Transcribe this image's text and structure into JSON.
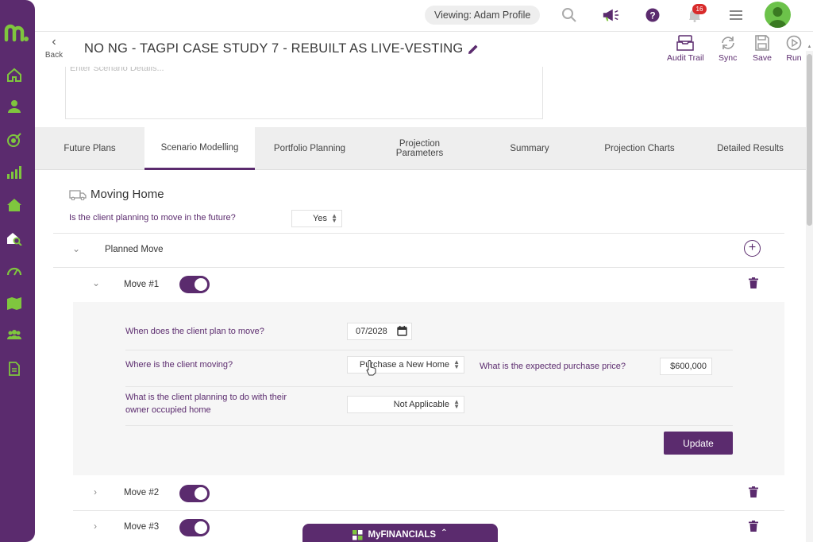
{
  "topbar": {
    "viewing_label": "Viewing: Adam Profile",
    "notification_count": "16"
  },
  "titlebar": {
    "back_label": "Back",
    "title": "NO NG - TAGPI CASE STUDY 7 - REBUILT AS LIVE-VESTING",
    "actions": {
      "audit_trail": "Audit Trail",
      "sync": "Sync",
      "save": "Save",
      "run": "Run"
    }
  },
  "details": {
    "placeholder": "Enter Scenario Details..."
  },
  "tabs": [
    {
      "label": "Future Plans",
      "active": false
    },
    {
      "label": "Scenario Modelling",
      "active": true
    },
    {
      "label": "Portfolio Planning",
      "active": false
    },
    {
      "label": "Projection Parameters",
      "active": false
    },
    {
      "label": "Summary",
      "active": false
    },
    {
      "label": "Projection Charts",
      "active": false
    },
    {
      "label": "Detailed Results",
      "active": false
    }
  ],
  "section": {
    "title": "Moving Home",
    "question": "Is the client planning to move in the future?",
    "answer": "Yes",
    "group_label": "Planned Move"
  },
  "moves": [
    {
      "label": "Move #1",
      "enabled": true,
      "expanded": true
    },
    {
      "label": "Move #2",
      "enabled": true,
      "expanded": false
    },
    {
      "label": "Move #3",
      "enabled": true,
      "expanded": false
    }
  ],
  "move_form": {
    "when_label": "When does the client plan to move?",
    "when_value": "07/2028",
    "where_label": "Where is the client moving?",
    "where_value": "Purchase a New Home",
    "price_label": "What is the expected purchase price?",
    "price_value": "$600,000",
    "owner_label_line1": "What is the client planning to do with their",
    "owner_label_line2": "owner occupied home",
    "owner_value": "Not Applicable",
    "update_label": "Update"
  },
  "footer": {
    "myfinancials_label": "MyFINANCIALS"
  },
  "colors": {
    "brand": "#5b2b6e",
    "accent_green": "#6cc24a",
    "badge_red": "#d82b2b"
  }
}
